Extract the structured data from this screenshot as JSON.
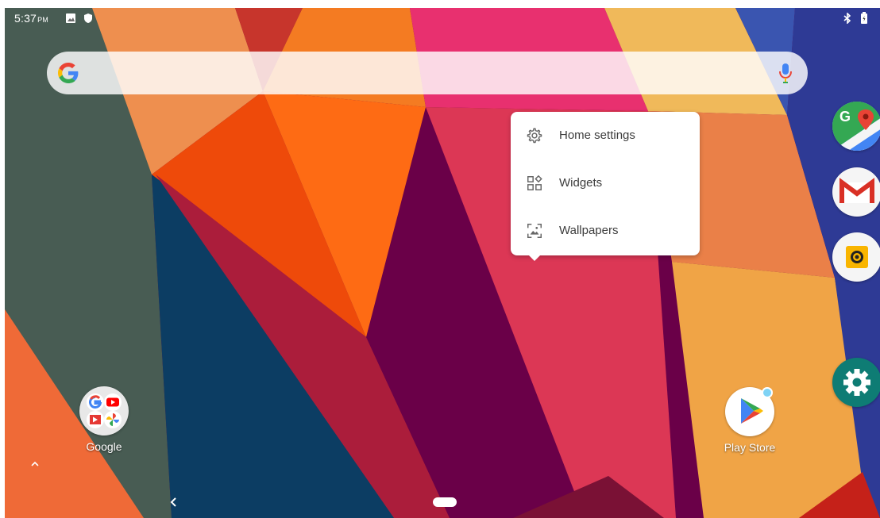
{
  "status_bar": {
    "time": "5:37",
    "ampm": "PM",
    "left_icons": [
      "image-icon",
      "shield-icon"
    ],
    "right_icons": [
      "bluetooth-icon",
      "battery-icon"
    ]
  },
  "search": {
    "icons": [
      "google-g-icon",
      "mic-icon"
    ]
  },
  "popup_menu": {
    "items": [
      {
        "label": "Home settings",
        "icon": "gear-icon"
      },
      {
        "label": "Widgets",
        "icon": "widgets-icon"
      },
      {
        "label": "Wallpapers",
        "icon": "wallpaper-icon"
      }
    ]
  },
  "desktop_apps": [
    {
      "label": "Google",
      "icon": "google-folder-icon"
    },
    {
      "label": "Play Store",
      "icon": "play-store-icon",
      "badge": true
    }
  ],
  "dock": [
    {
      "icon": "google-maps-icon"
    },
    {
      "icon": "gmail-icon"
    },
    {
      "icon": "camera-icon"
    },
    {
      "icon": "settings-icon"
    }
  ],
  "navigation": {
    "icons": [
      "app-drawer-up-icon",
      "back-icon",
      "home-pill-icon"
    ]
  },
  "colors": {
    "accent_blue": "#4285F4",
    "google_red": "#EA4335",
    "google_yellow": "#FBBC05",
    "google_green": "#34A853",
    "settings_teal": "#0E7C74"
  }
}
